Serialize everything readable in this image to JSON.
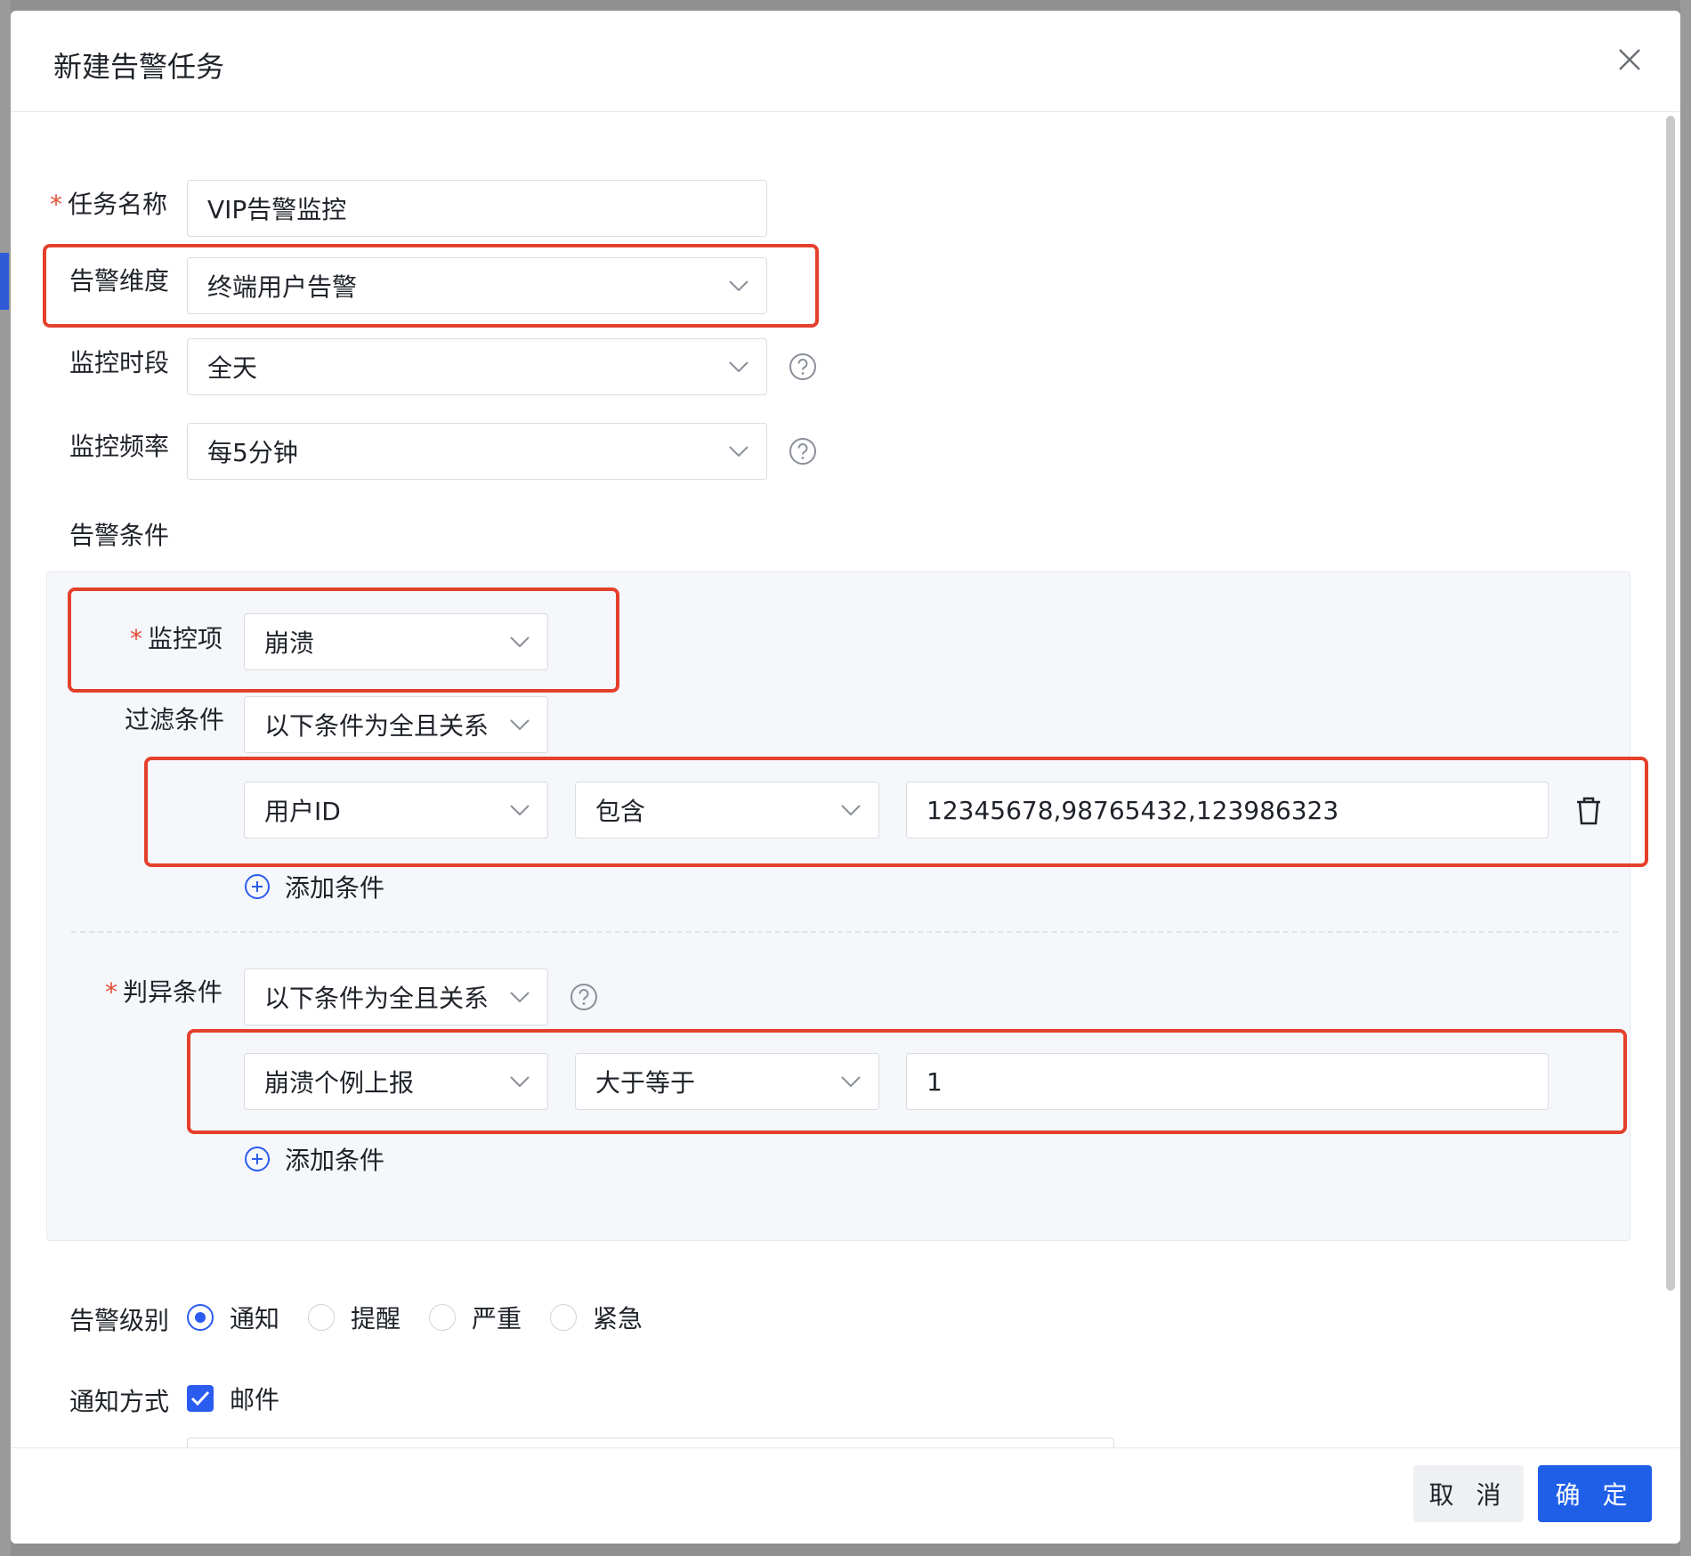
{
  "dialog": {
    "title": "新建告警任务"
  },
  "form": {
    "task_name": {
      "label": "任务名称",
      "value": "VIP告警监控"
    },
    "dimension": {
      "label": "告警维度",
      "value": "终端用户告警"
    },
    "period": {
      "label": "监控时段",
      "value": "全天"
    },
    "frequency": {
      "label": "监控频率",
      "value": "每5分钟"
    },
    "conditions_label": "告警条件"
  },
  "conditions": {
    "monitor_item": {
      "label": "监控项",
      "value": "崩溃"
    },
    "filter": {
      "label": "过滤条件",
      "relation": "以下条件为全且关系",
      "row": {
        "field": "用户ID",
        "operator": "包含",
        "value": "12345678,98765432,123986323"
      },
      "add_label": "添加条件"
    },
    "judge": {
      "label": "判异条件",
      "relation": "以下条件为全且关系",
      "row": {
        "field": "崩溃个例上报",
        "operator": "大于等于",
        "value": "1"
      },
      "add_label": "添加条件"
    }
  },
  "level": {
    "label": "告警级别",
    "options": [
      "通知",
      "提醒",
      "严重",
      "紧急"
    ],
    "selected": "通知"
  },
  "notify": {
    "label": "通知方式",
    "email_label": "邮件",
    "email_checked": true
  },
  "footer": {
    "cancel": "取 消",
    "ok": "确 定"
  },
  "colors": {
    "primary": "#1f5fe8",
    "required": "#e34d35",
    "highlight": "#e4402b"
  }
}
